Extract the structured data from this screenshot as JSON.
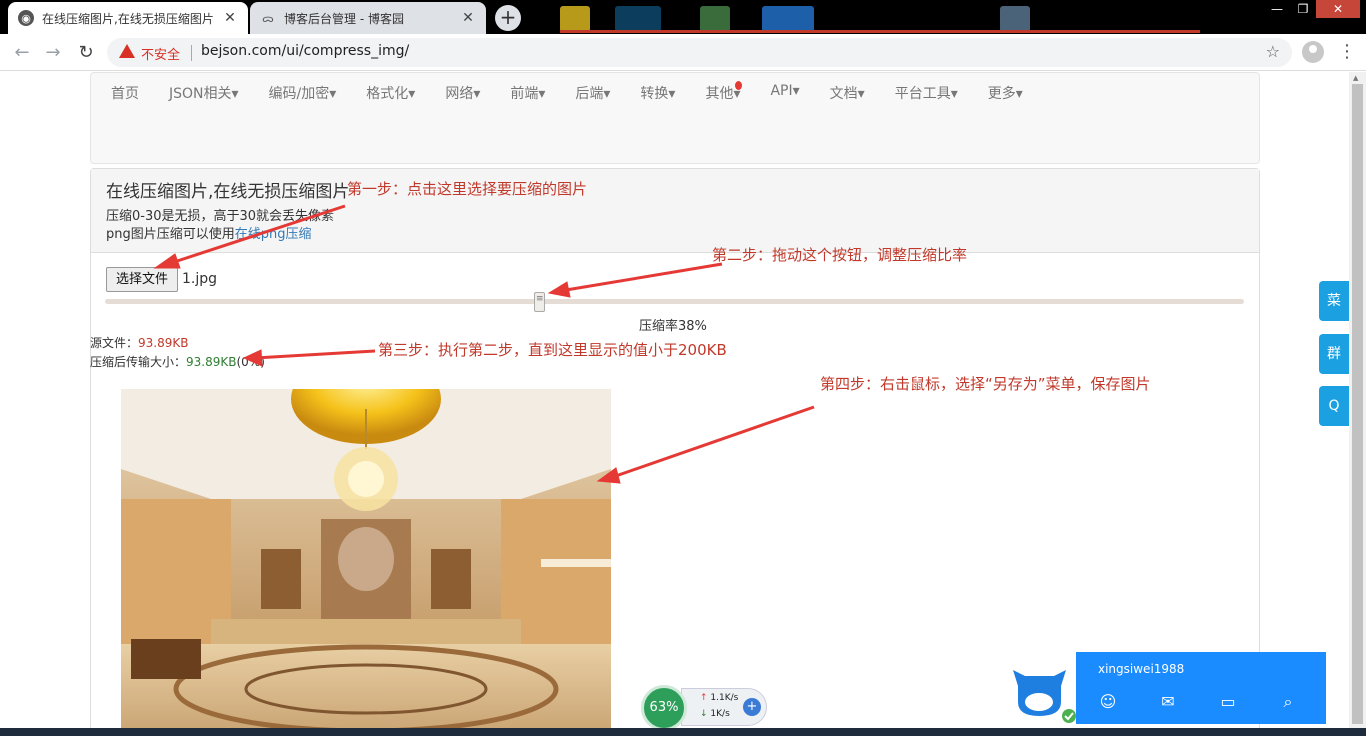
{
  "browser": {
    "tabs": [
      {
        "title": "在线压缩图片,在线无损压缩图片",
        "close": "✕"
      },
      {
        "title": "博客后台管理 - 博客园",
        "close": "✕"
      }
    ],
    "new_tab": "+",
    "security_label": "不安全",
    "url": "bejson.com/ui/compress_img/",
    "back_icon": "←",
    "forward_icon": "→",
    "reload_icon": "↻",
    "star_icon": "☆",
    "menu_icon": "⋮",
    "window_controls": [
      "—",
      "❐",
      "✕"
    ]
  },
  "nav": {
    "items": [
      "首页",
      "JSON相关▾",
      "编码/加密▾",
      "格式化▾",
      "网络▾",
      "前端▾",
      "后端▾",
      "转换▾",
      "其他▾",
      "API▾",
      "文档▾",
      "平台工具▾",
      "更多▾"
    ]
  },
  "panel": {
    "title": "在线压缩图片,在线无损压缩图片",
    "note1": "压缩0-30是无损，高于30就会丢失像素",
    "note2_prefix": "png图片压缩可以使用",
    "note2_link": "在线png压缩"
  },
  "compressor": {
    "file_button": "选择文件",
    "file_name": "1.jpg",
    "rate_label": "压缩率",
    "rate_value": "38%",
    "source_label": "源文件：",
    "source_size": "93.89KB",
    "compressed_label": "压缩后传输大小：",
    "compressed_size": "93.89KB",
    "compressed_suffix": "(0%)"
  },
  "annotations": {
    "step1": "第一步：点击这里选择要压缩的图片",
    "step2": "第二步：拖动这个按钮，调整压缩比率",
    "step3": "第三步：执行第二步，直到这里显示的值小于200KB",
    "step4": "第四步：右击鼠标，选择“另存为”菜单，保存图片"
  },
  "side_tabs": [
    "菜",
    "群",
    "Q"
  ],
  "net_widget": {
    "percent": "63%",
    "up": "1.1K/s",
    "down": "1K/s",
    "plus": "+"
  },
  "qq_popup": {
    "username": "xingsiwei1988",
    "icons": [
      "smile-icon",
      "mail-icon",
      "wallet-icon",
      "search-icon"
    ]
  },
  "colors": {
    "annotation": "#c0392b",
    "accent": "#1ba1e2",
    "link": "#337ab7"
  }
}
